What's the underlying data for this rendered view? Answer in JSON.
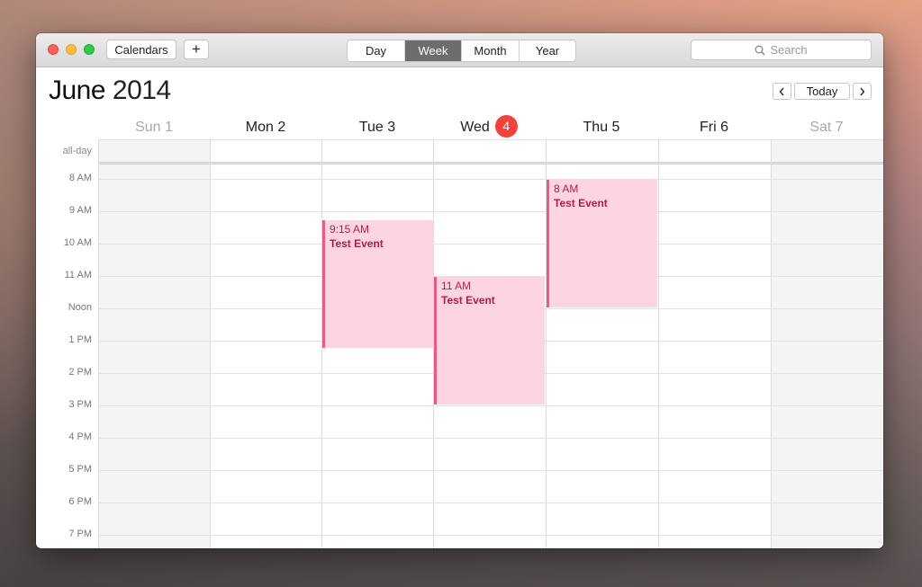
{
  "toolbar": {
    "calendars_label": "Calendars",
    "add_label": "+",
    "views": [
      "Day",
      "Week",
      "Month",
      "Year"
    ],
    "active_view": "Week",
    "search_placeholder": "Search"
  },
  "header": {
    "month": "June",
    "year": "2014",
    "prev_label": "‹",
    "today_label": "Today",
    "next_label": "›"
  },
  "days": [
    {
      "name": "Sun 1",
      "weekend": true
    },
    {
      "name": "Mon 2",
      "weekend": false
    },
    {
      "name": "Tue 3",
      "weekend": false
    },
    {
      "name": "Wed",
      "badge": "4",
      "weekend": false
    },
    {
      "name": "Thu 5",
      "weekend": false
    },
    {
      "name": "Fri 6",
      "weekend": false
    },
    {
      "name": "Sat 7",
      "weekend": true
    }
  ],
  "allday_label": "all-day",
  "hours": [
    "8 AM",
    "9 AM",
    "10 AM",
    "11 AM",
    "Noon",
    "1 PM",
    "2 PM",
    "3 PM",
    "4 PM",
    "5 PM",
    "6 PM",
    "7 PM"
  ],
  "events": [
    {
      "day": 2,
      "start_hour": 9.25,
      "end_hour": 13.25,
      "time": "9:15 AM",
      "title": "Test Event"
    },
    {
      "day": 3,
      "start_hour": 11.0,
      "end_hour": 15.0,
      "time": "11 AM",
      "title": "Test Event"
    },
    {
      "day": 4,
      "start_hour": 8.0,
      "end_hour": 12.0,
      "time": "8 AM",
      "title": "Test Event"
    }
  ],
  "colors": {
    "event_fill": "#fdd5e1",
    "event_border": "#e95a85",
    "event_text": "#b31d4a",
    "today_badge": "#f2433b",
    "active_segment": "#6d6d6d"
  }
}
